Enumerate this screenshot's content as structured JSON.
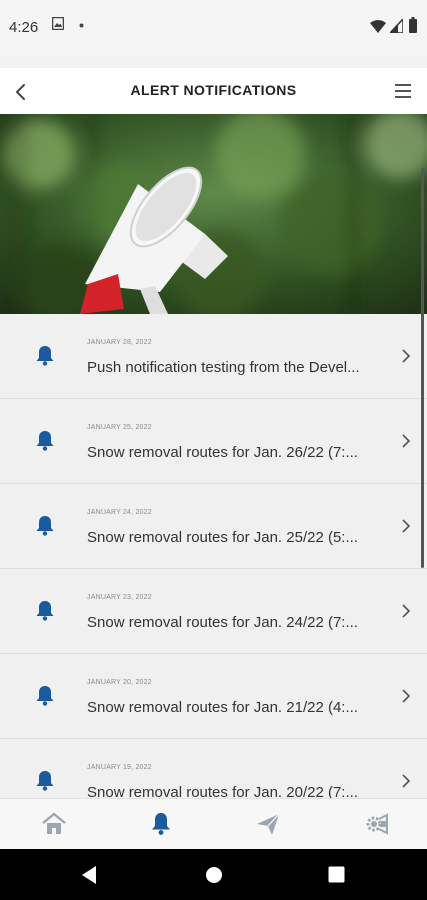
{
  "status_bar": {
    "time": "4:26"
  },
  "header": {
    "title": "ALERT NOTIFICATIONS"
  },
  "notifications": [
    {
      "date": "JANUARY 28, 2022",
      "title": "Push notification testing from the Devel..."
    },
    {
      "date": "JANUARY 25, 2022",
      "title": "Snow removal routes for Jan. 26/22 (7:..."
    },
    {
      "date": "JANUARY 24, 2022",
      "title": "Snow removal routes for Jan. 25/22 (5:..."
    },
    {
      "date": "JANUARY 23, 2022",
      "title": "Snow removal routes for Jan. 24/22 (7:..."
    },
    {
      "date": "JANUARY 20, 2022",
      "title": "Snow removal routes for Jan. 21/22 (4:..."
    },
    {
      "date": "JANUARY 19, 2022",
      "title": "Snow removal routes for Jan. 20/22 (7:..."
    }
  ],
  "tabs": [
    {
      "icon": "home-icon",
      "active": false
    },
    {
      "icon": "bell-icon",
      "active": true
    },
    {
      "icon": "paper-plane-icon",
      "active": false
    },
    {
      "icon": "settings-icon",
      "active": false
    }
  ],
  "colors": {
    "accent": "#1a5a9e",
    "inactive_tab": "#9aa6b2",
    "megaphone_red": "#d3222a"
  }
}
